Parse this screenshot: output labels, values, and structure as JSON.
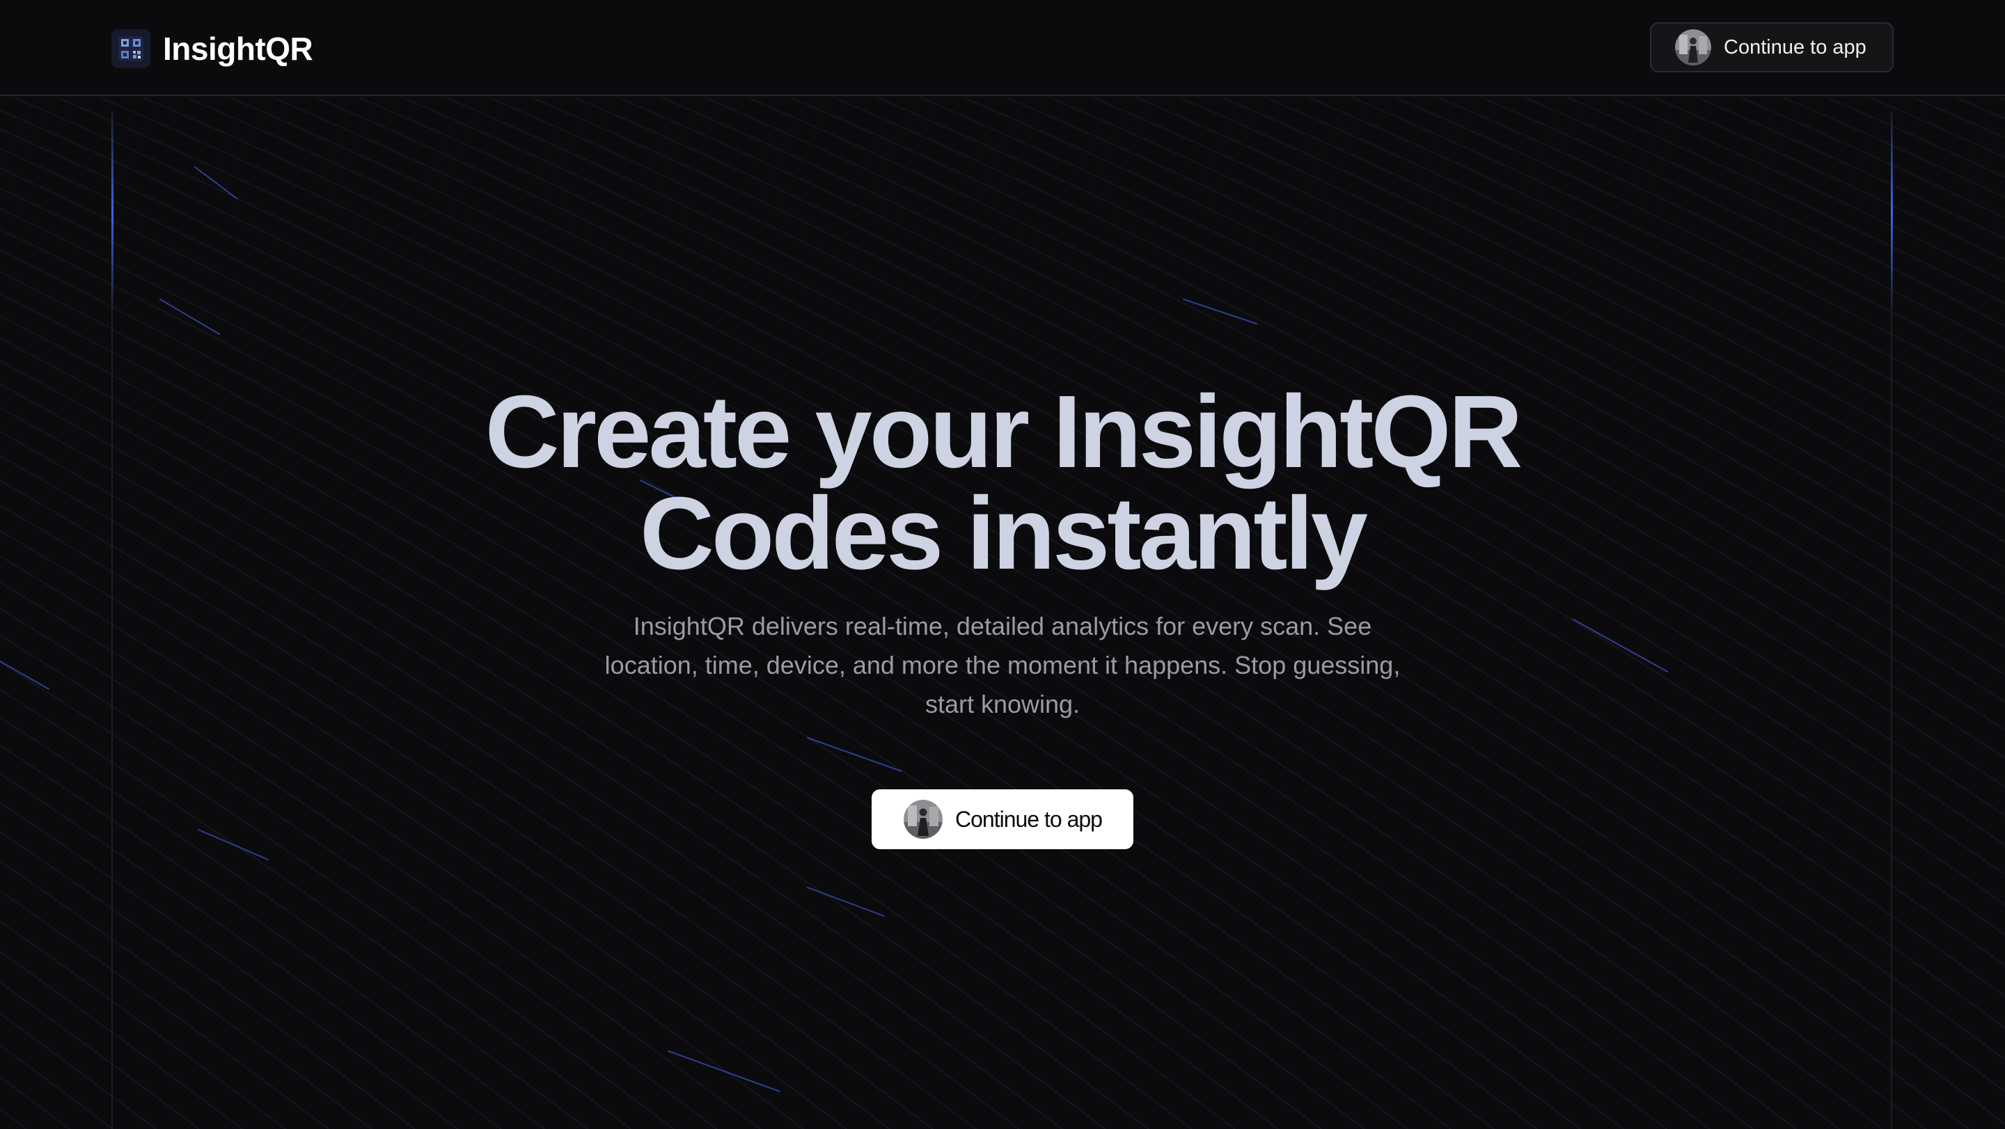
{
  "app": {
    "name": "InsightQR",
    "logo_icon": "qr-code-icon"
  },
  "navbar": {
    "cta_label": "Continue to app",
    "cta_avatar": "user-avatar"
  },
  "hero": {
    "title_line_1": "Create your InsightQR",
    "title_line_2": "Codes instantly",
    "subtitle": "InsightQR delivers real-time, detailed analytics for every scan. See location, time, device, and more the moment it happens. Stop guessing, start knowing.",
    "cta_label": "Continue to app",
    "cta_avatar": "user-avatar"
  },
  "colors": {
    "background": "#0b0b0d",
    "title": "#cdd3e3",
    "subtitle": "#9a9ca4",
    "accent_streak": "#4a6cff",
    "cta_light": "#ffffff",
    "cta_dark": "#151518"
  }
}
